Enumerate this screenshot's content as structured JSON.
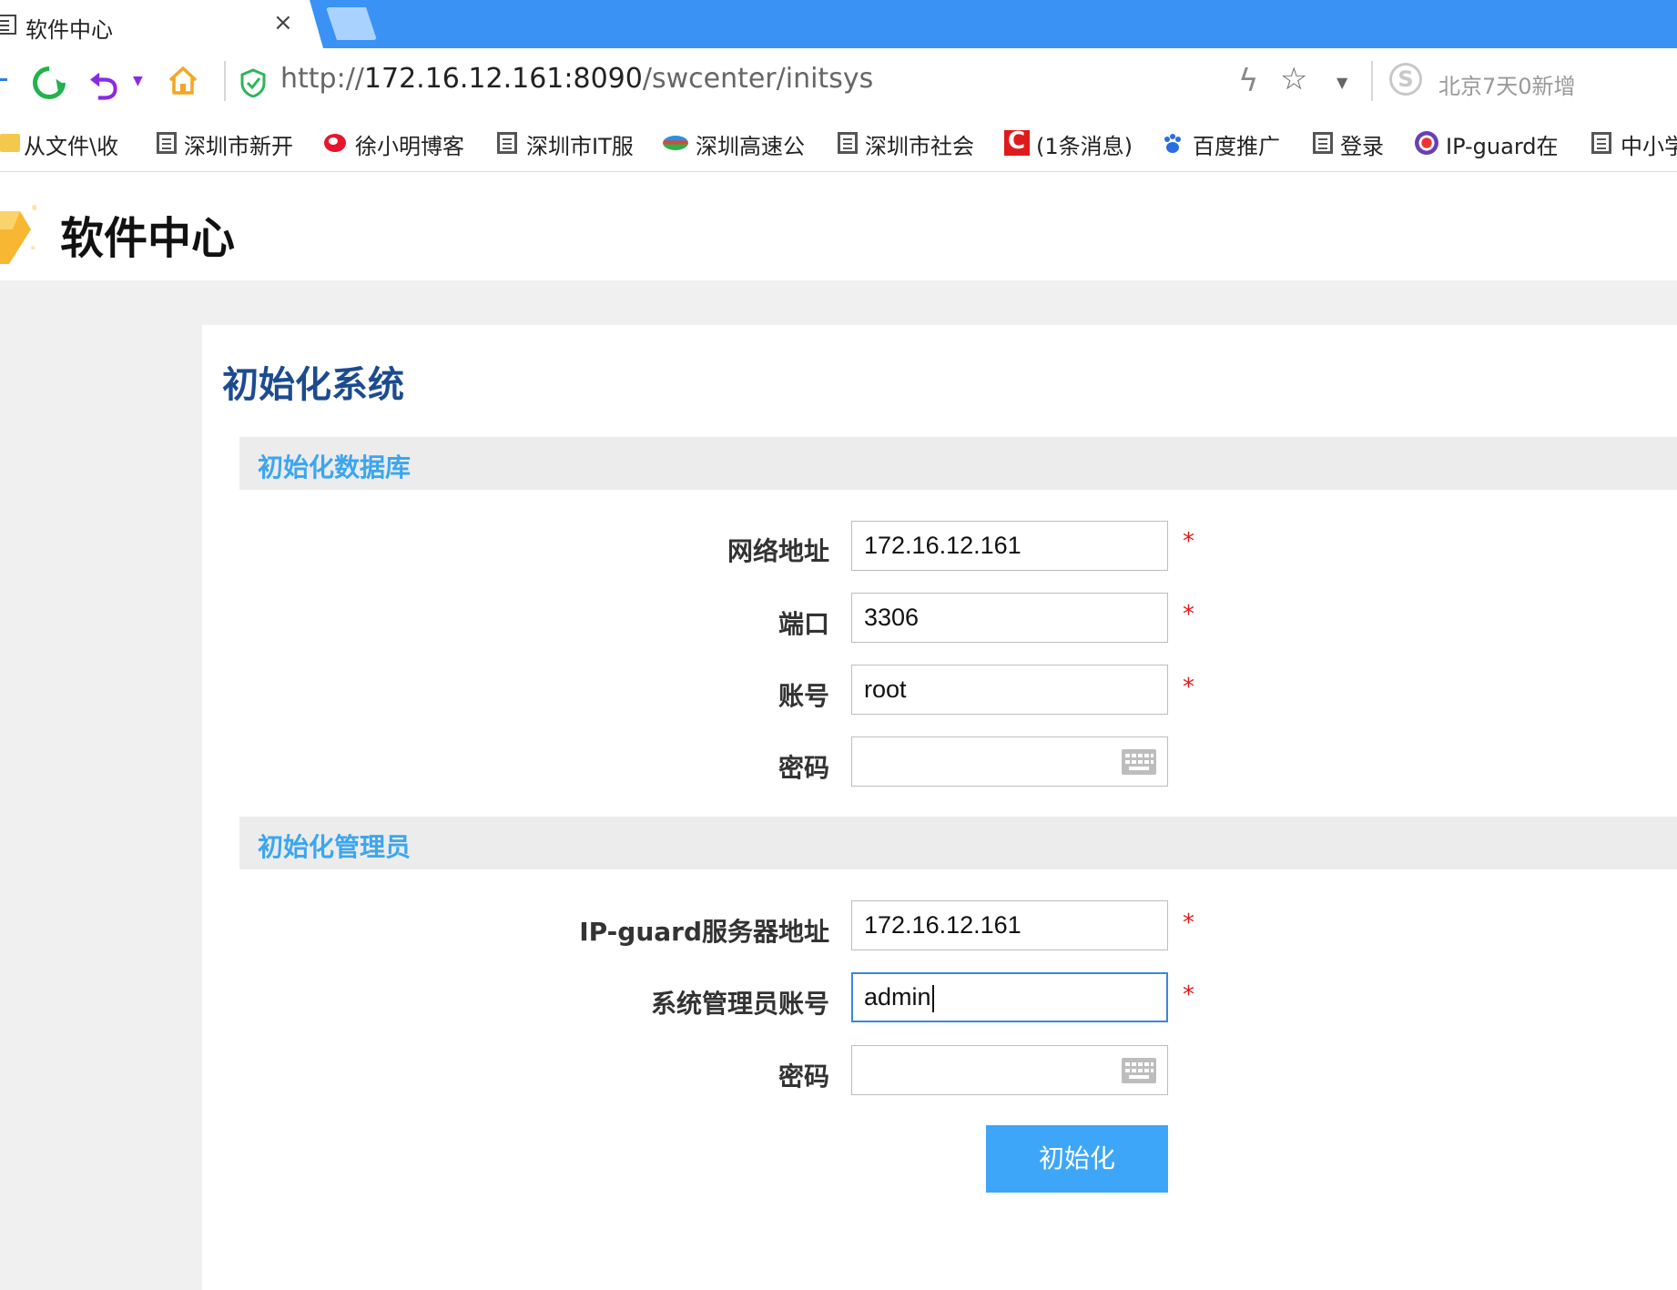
{
  "browser": {
    "tab_title": "软件中心",
    "tab_close": "×",
    "url_scheme": "http://",
    "url_host": "172.16.12.161:8090",
    "url_path": "/swcenter/initsys",
    "news_text": "北京7天0新增",
    "icons": [
      "refresh-icon",
      "undo-icon",
      "home-icon",
      "shield-icon",
      "bolt-icon",
      "star-icon",
      "sogou-icon"
    ],
    "accent_color": "#3a93f4"
  },
  "bookmarks": [
    {
      "label": "从文件\\收",
      "icon": "folder-icon"
    },
    {
      "label": "深圳市新开",
      "icon": "doc-icon"
    },
    {
      "label": "徐小明博客",
      "icon": "weibo-icon"
    },
    {
      "label": "深圳市IT服",
      "icon": "doc-icon"
    },
    {
      "label": "深圳高速公",
      "icon": "globe-icon"
    },
    {
      "label": "深圳市社会",
      "icon": "doc-icon"
    },
    {
      "label": "(1条消息)",
      "icon": "csdn-icon"
    },
    {
      "label": "百度推广",
      "icon": "baidu-paw-icon"
    },
    {
      "label": "登录",
      "icon": "doc-icon"
    },
    {
      "label": "IP-guard在",
      "icon": "ipguard-icon"
    },
    {
      "label": "中小学",
      "icon": "doc-icon"
    }
  ],
  "site": {
    "title": "软件中心"
  },
  "page": {
    "title": "初始化系统",
    "title_color": "#1c4b8f",
    "section_color": "#3ba6ef",
    "required_mark": "*",
    "db_section": {
      "title": "初始化数据库",
      "host_label": "网络地址",
      "host_value": "172.16.12.161",
      "port_label": "端口",
      "port_value": "3306",
      "account_label": "账号",
      "account_value": "root",
      "password_label": "密码",
      "password_value": ""
    },
    "admin_section": {
      "title": "初始化管理员",
      "server_label": "IP-guard服务器地址",
      "server_value": "172.16.12.161",
      "admin_label": "系统管理员账号",
      "admin_value": "admin",
      "password_label": "密码",
      "password_value": ""
    },
    "submit_label": "初始化",
    "button_color": "#3ea6f8"
  }
}
